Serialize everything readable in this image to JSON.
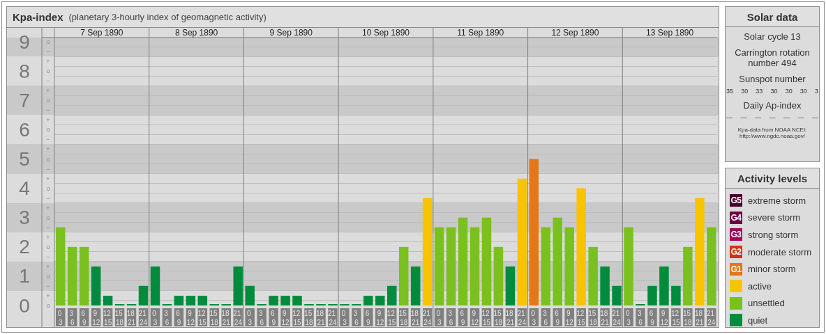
{
  "kp_panel": {
    "title": "Kpa-index",
    "subtitle": "(planetary 3-hourly index of geomagnetic activity)",
    "minor_ticks": [
      "o",
      "−",
      "+",
      "o",
      "−",
      "+",
      "o",
      "−",
      "+",
      "o",
      "−",
      "+",
      "o",
      "−",
      "+",
      "o",
      "−",
      "+",
      "o",
      "−",
      "+",
      "o",
      "−",
      "+",
      "o",
      "−",
      "+",
      "o"
    ],
    "days": [
      {
        "date": "7 Sep 1890",
        "intervals": [
          {
            "from": "0",
            "to": "3"
          },
          {
            "from": "3",
            "to": "6"
          },
          {
            "from": "6",
            "to": "9"
          },
          {
            "from": "9",
            "to": "12"
          },
          {
            "from": "12",
            "to": "15"
          },
          {
            "from": "15",
            "to": "18"
          },
          {
            "from": "18",
            "to": "21"
          },
          {
            "from": "21",
            "to": "24"
          }
        ]
      },
      {
        "date": "8 Sep 1890",
        "intervals": [
          {
            "from": "0",
            "to": "3"
          },
          {
            "from": "3",
            "to": "6"
          },
          {
            "from": "6",
            "to": "9"
          },
          {
            "from": "9",
            "to": "12"
          },
          {
            "from": "12",
            "to": "15"
          },
          {
            "from": "15",
            "to": "18"
          },
          {
            "from": "18",
            "to": "21"
          },
          {
            "from": "21",
            "to": "24"
          }
        ]
      },
      {
        "date": "9 Sep 1890",
        "intervals": [
          {
            "from": "0",
            "to": "3"
          },
          {
            "from": "3",
            "to": "6"
          },
          {
            "from": "6",
            "to": "9"
          },
          {
            "from": "9",
            "to": "12"
          },
          {
            "from": "12",
            "to": "15"
          },
          {
            "from": "15",
            "to": "18"
          },
          {
            "from": "18",
            "to": "21"
          },
          {
            "from": "21",
            "to": "24"
          }
        ]
      },
      {
        "date": "10 Sep 1890",
        "intervals": [
          {
            "from": "0",
            "to": "3"
          },
          {
            "from": "3",
            "to": "6"
          },
          {
            "from": "6",
            "to": "9"
          },
          {
            "from": "9",
            "to": "12"
          },
          {
            "from": "12",
            "to": "15"
          },
          {
            "from": "15",
            "to": "18"
          },
          {
            "from": "18",
            "to": "21"
          },
          {
            "from": "21",
            "to": "24"
          }
        ]
      },
      {
        "date": "11 Sep 1890",
        "intervals": [
          {
            "from": "0",
            "to": "3"
          },
          {
            "from": "3",
            "to": "6"
          },
          {
            "from": "6",
            "to": "9"
          },
          {
            "from": "9",
            "to": "12"
          },
          {
            "from": "12",
            "to": "15"
          },
          {
            "from": "15",
            "to": "18"
          },
          {
            "from": "18",
            "to": "21"
          },
          {
            "from": "21",
            "to": "24"
          }
        ]
      },
      {
        "date": "12 Sep 1890",
        "intervals": [
          {
            "from": "0",
            "to": "3"
          },
          {
            "from": "3",
            "to": "6"
          },
          {
            "from": "6",
            "to": "9"
          },
          {
            "from": "9",
            "to": "12"
          },
          {
            "from": "12",
            "to": "15"
          },
          {
            "from": "15",
            "to": "18"
          },
          {
            "from": "18",
            "to": "21"
          },
          {
            "from": "21",
            "to": "24"
          }
        ]
      },
      {
        "date": "13 Sep 1890",
        "intervals": [
          {
            "from": "0",
            "to": "3"
          },
          {
            "from": "3",
            "to": "6"
          },
          {
            "from": "6",
            "to": "9"
          },
          {
            "from": "9",
            "to": "12"
          },
          {
            "from": "12",
            "to": "15"
          },
          {
            "from": "15",
            "to": "18"
          },
          {
            "from": "18",
            "to": "21"
          },
          {
            "from": "21",
            "to": "24"
          }
        ]
      }
    ],
    "chart_data": {
      "type": "bar",
      "stacked": true,
      "grid": true,
      "ylim": [
        0,
        9.15
      ],
      "yticks": [
        0,
        1,
        2,
        3,
        4,
        5,
        6,
        7,
        8,
        9
      ],
      "series": [
        {
          "color": "#008c3c",
          "values": [
            null,
            null,
            null,
            1.33,
            0.33,
            0,
            0,
            0.67,
            1.33,
            0,
            0.33,
            0.33,
            0.33,
            0,
            0,
            1.33,
            0.67,
            0,
            0.33,
            0.33,
            0.33,
            0,
            0,
            0,
            0,
            0,
            0.33,
            0.33,
            0.67,
            null,
            1.33,
            null,
            null,
            null,
            null,
            null,
            null,
            null,
            1.33,
            null,
            null,
            null,
            null,
            null,
            null,
            null,
            1.33,
            0.67,
            null,
            0,
            0.67,
            1.33,
            0.67,
            null,
            null,
            null
          ]
        },
        {
          "color": "#7ac120",
          "values": [
            2.67,
            2,
            2,
            null,
            null,
            null,
            null,
            null,
            null,
            null,
            null,
            null,
            null,
            null,
            null,
            null,
            null,
            null,
            null,
            null,
            null,
            null,
            null,
            null,
            null,
            null,
            null,
            null,
            null,
            2,
            null,
            null,
            2.67,
            2.67,
            3,
            2.67,
            3,
            2,
            null,
            null,
            null,
            2.67,
            3,
            2.67,
            null,
            2,
            null,
            null,
            2.67,
            null,
            null,
            null,
            null,
            2,
            null,
            2.67
          ]
        },
        {
          "color": "#f8c400",
          "values": [
            null,
            null,
            null,
            null,
            null,
            null,
            null,
            null,
            null,
            null,
            null,
            null,
            null,
            null,
            null,
            null,
            null,
            null,
            null,
            null,
            null,
            null,
            null,
            null,
            null,
            null,
            null,
            null,
            null,
            null,
            null,
            3.67,
            null,
            null,
            null,
            null,
            null,
            null,
            null,
            4.33,
            null,
            null,
            null,
            null,
            4,
            null,
            null,
            null,
            null,
            null,
            null,
            null,
            null,
            null,
            3.67,
            null
          ]
        },
        {
          "color": "#e57716",
          "values": [
            null,
            null,
            null,
            null,
            null,
            null,
            null,
            null,
            null,
            null,
            null,
            null,
            null,
            null,
            null,
            null,
            null,
            null,
            null,
            null,
            null,
            null,
            null,
            null,
            null,
            null,
            null,
            null,
            null,
            null,
            null,
            null,
            null,
            null,
            null,
            null,
            null,
            null,
            null,
            null,
            5,
            null,
            null,
            null,
            null,
            null,
            null,
            null,
            null,
            null,
            null,
            null,
            null,
            null,
            null,
            null
          ]
        }
      ]
    }
  },
  "solar_data": {
    "title": "Solar data",
    "solar_cycle": "Solar cycle 13",
    "carrington_rotation": "Carrington rotation number 494",
    "sunspot_label": "Sunspot number",
    "sunspot_numbers": [
      "35",
      "30",
      "33",
      "30",
      "30",
      "30",
      "3"
    ],
    "ap_label": "Daily Ap-index",
    "ap_values": [
      "—",
      "—",
      "—",
      "—",
      "—",
      "—",
      "—"
    ],
    "source_lines": [
      "Kpa-data from NOAA NCEI:",
      "http://www.ngdc.noaa.gov/"
    ]
  },
  "activity_levels": {
    "title": "Activity levels",
    "items": [
      {
        "badge": "G5",
        "label": "extreme storm",
        "color": "#4a0030"
      },
      {
        "badge": "G4",
        "label": "severe storm",
        "color": "#6b0040"
      },
      {
        "badge": "G3",
        "label": "strong storm",
        "color": "#a8005a"
      },
      {
        "badge": "G2",
        "label": "moderate storm",
        "color": "#d4321b"
      },
      {
        "badge": "G1",
        "label": "minor storm",
        "color": "#e57716"
      },
      {
        "label": "active",
        "color": "#f8c400"
      },
      {
        "label": "unsettled",
        "color": "#7ac120"
      },
      {
        "label": "quiet",
        "color": "#008c3c"
      }
    ]
  }
}
